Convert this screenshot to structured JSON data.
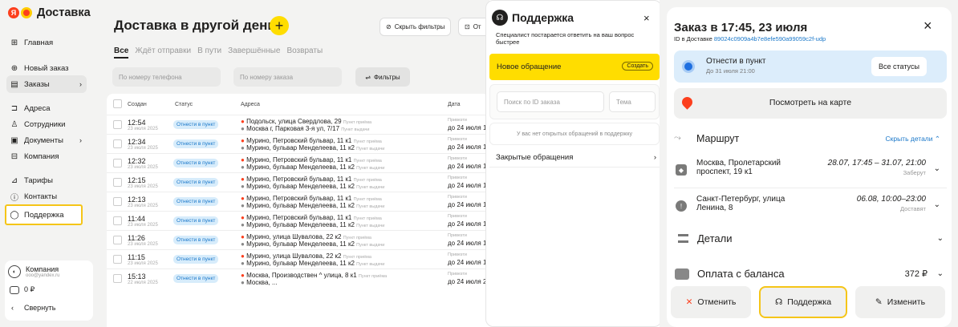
{
  "app": {
    "logo_letter": "Я",
    "logo_text": "Доставка",
    "nav": [
      {
        "label": "Главная",
        "icon": "grid-icon",
        "glyph": "⊞"
      },
      {
        "label": "Новый заказ",
        "icon": "plus-circle-icon",
        "glyph": "⊕"
      },
      {
        "label": "Заказы",
        "icon": "calendar-icon",
        "glyph": "▤",
        "arrow": "›"
      },
      {
        "label": "Адреса",
        "icon": "bookmark-icon",
        "glyph": "⊐"
      },
      {
        "label": "Сотрудники",
        "icon": "person-icon",
        "glyph": "♙"
      },
      {
        "label": "Документы",
        "icon": "document-icon",
        "glyph": "▣",
        "arrow": "›"
      },
      {
        "label": "Компания",
        "icon": "building-icon",
        "glyph": "⊟"
      },
      {
        "label": "Тарифы",
        "icon": "tariff-icon",
        "glyph": "⊿"
      },
      {
        "label": "Контакты",
        "icon": "info-icon",
        "glyph": "ⓘ"
      },
      {
        "label": "Поддержка",
        "icon": "chat-icon",
        "glyph": "◯"
      }
    ],
    "account": {
      "name": "Компания",
      "email": "ooo@yandex.ru",
      "balance": "0 ₽",
      "collapse": "Свернуть",
      "collapse_arrow": "‹"
    }
  },
  "orders": {
    "title": "Доставка в другой день",
    "plus": "+",
    "hide_filters": "Скрыть фильтры",
    "hide_filters_glyph": "⊘",
    "cut_button": "От",
    "cut_button_glyph": "⊡",
    "tabs": [
      "Все",
      "Ждёт отправки",
      "В пути",
      "Завершённые",
      "Возвраты"
    ],
    "phone_placeholder": "По номеру телефона",
    "order_placeholder": "По номеру заказа",
    "filters": "Фильтры",
    "filters_glyph": "⇌",
    "headers": [
      "Создан",
      "Статус",
      "Адреса",
      "Дата"
    ],
    "rows": [
      {
        "time": "12:54",
        "date": "23 июля 2025",
        "status": "Отнести в пункт",
        "from": "Подольск, улица Свердлова, 29",
        "from_hint": "Пункт приёма",
        "to": "Москва г, Парковая 3-я ул, 7/17",
        "to_hint": "Пункт выдачи",
        "d1": "Привезти",
        "d2": "до 24 июля 1"
      },
      {
        "time": "12:34",
        "date": "23 июля 2025",
        "status": "Отнести в пункт",
        "from": "Мурино, Петровский бульвар, 11 к1",
        "from_hint": "Пункт приёма",
        "to": "Мурино, бульвар Менделеева, 11 к2",
        "to_hint": "Пункт выдачи",
        "d1": "Привезти",
        "d2": "до 24 июля 1"
      },
      {
        "time": "12:32",
        "date": "23 июля 2025",
        "status": "Отнести в пункт",
        "from": "Мурино, Петровский бульвар, 11 к1",
        "from_hint": "Пункт приёма",
        "to": "Мурино, бульвар Менделеева, 11 к2",
        "to_hint": "Пункт выдачи",
        "d1": "Привезти",
        "d2": "до 24 июля 1"
      },
      {
        "time": "12:15",
        "date": "23 июля 2025",
        "status": "Отнести в пункт",
        "from": "Мурино, Петровский бульвар, 11 к1",
        "from_hint": "Пункт приёма",
        "to": "Мурино, бульвар Менделеева, 11 к2",
        "to_hint": "Пункт выдачи",
        "d1": "Привезти",
        "d2": "до 24 июля 1"
      },
      {
        "time": "12:13",
        "date": "23 июля 2025",
        "status": "Отнести в пункт",
        "from": "Мурино, Петровский бульвар, 11 к1",
        "from_hint": "Пункт приёма",
        "to": "Мурино, бульвар Менделеева, 11 к2",
        "to_hint": "Пункт выдачи",
        "d1": "Привезти",
        "d2": "до 24 июля 1"
      },
      {
        "time": "11:44",
        "date": "23 июля 2025",
        "status": "Отнести в пункт",
        "from": "Мурино, Петровский бульвар, 11 к1",
        "from_hint": "Пункт приёма",
        "to": "Мурино, бульвар Менделеева, 11 к2",
        "to_hint": "Пункт выдачи",
        "d1": "Привезти",
        "d2": "до 24 июля 1"
      },
      {
        "time": "11:26",
        "date": "23 июля 2025",
        "status": "Отнести в пункт",
        "from": "Мурино, улица Шувалова, 22 к2",
        "from_hint": "Пункт приёма",
        "to": "Мурино, бульвар Менделеева, 11 к2",
        "to_hint": "Пункт выдачи",
        "d1": "Привезти",
        "d2": "до 24 июля 1"
      },
      {
        "time": "11:15",
        "date": "23 июля 2025",
        "status": "Отнести в пункт",
        "from": "Мурино, улица Шувалова, 22 к2",
        "from_hint": "Пункт приёма",
        "to": "Мурино, бульвар Менделеева, 11 к2",
        "to_hint": "Пункт выдачи",
        "d1": "Привезти",
        "d2": "до 24 июля 1"
      },
      {
        "time": "15:13",
        "date": "22 июля 2025",
        "status": "Отнести в пункт",
        "from": "Москва, Производствен ^ улица, 8 к1",
        "from_hint": "Пункт приёма",
        "to": "Москва, ...",
        "to_hint": "",
        "d1": "Привезти",
        "d2": "до 24 июля 21"
      }
    ]
  },
  "support": {
    "title": "Поддержка",
    "glyph": "☊",
    "close": "×",
    "subtitle": "Специалист постарается ответить на ваш вопрос быстрее",
    "new_ticket": "Новое обращение",
    "create": "Создать",
    "search_placeholder": "Поиск по ID заказа",
    "topic_placeholder": "Тема",
    "empty": "У вас нет открытых обращений в поддержку",
    "closed": "Закрытые обращения",
    "closed_arrow": "›"
  },
  "order": {
    "title": "Заказ в 17:45, 23 июля",
    "id_prefix": "ID в Доставке",
    "id": "89024c0909a4b7e8efe590a99059c2f-udp",
    "close": "×",
    "status": "Отнести в пункт",
    "status_deadline": "До 31 июля 21:00",
    "all_statuses": "Все статусы",
    "map": "Посмотреть на карте",
    "route": "Маршрут",
    "route_glyph": "⤳",
    "hide_details": "Скрыть детали",
    "hide_details_arrow": "⌃",
    "stops": [
      {
        "address": "Москва, Пролетарский проспект, 19 к1",
        "time": "28.07, 17:45 – 31.07, 21:00",
        "action": "Заберут",
        "glyph": "◆"
      },
      {
        "address": "Санкт-Петербург, улица Ленина, 8",
        "time": "06.08, 10:00–23:00",
        "action": "Доставят",
        "glyph": "!"
      }
    ],
    "details": "Детали",
    "payment": "Оплата с баланса",
    "amount": "372 ₽",
    "chevron": "⌄",
    "cancel": "Отменить",
    "cancel_glyph": "✕",
    "support": "Поддержка",
    "support_glyph": "☊",
    "edit": "Изменить",
    "edit_glyph": "✎"
  },
  "colors": {
    "accent": "#ffdd00",
    "brand": "#fc3f1d",
    "link": "#1977c9",
    "badge_bg": "#d7ecfb"
  }
}
